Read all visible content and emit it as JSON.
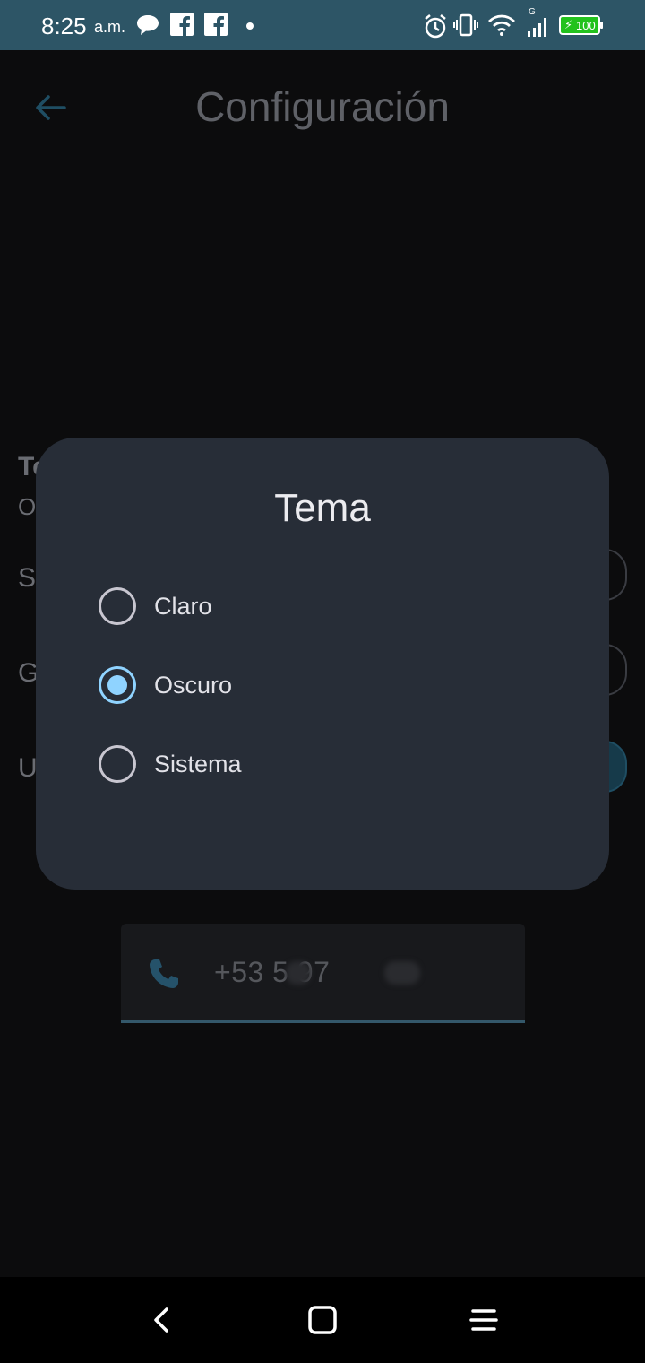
{
  "status_bar": {
    "time": "8:25",
    "ampm": "a.m.",
    "battery": "100",
    "network_label": "G",
    "icons": [
      "chat-bubble-icon",
      "facebook-icon",
      "facebook-icon",
      "alarm-icon",
      "vibrate-icon",
      "wifi-icon",
      "signal-icon",
      "battery-icon"
    ]
  },
  "appbar": {
    "title": "Configuración"
  },
  "background_rows": {
    "row1_letter": "Te",
    "row1_sub": "O",
    "row2_letter": "S",
    "row3_letter": "G",
    "row4_letter": "U"
  },
  "phone_field": {
    "value": "+53 5  97"
  },
  "dialog": {
    "title": "Tema",
    "options": [
      {
        "label": "Claro",
        "selected": false
      },
      {
        "label": "Oscuro",
        "selected": true
      },
      {
        "label": "Sistema",
        "selected": false
      }
    ]
  },
  "colors": {
    "status_bar": "#2d5566",
    "dialog_bg": "#272d37",
    "accent": "#8fd3ff"
  }
}
